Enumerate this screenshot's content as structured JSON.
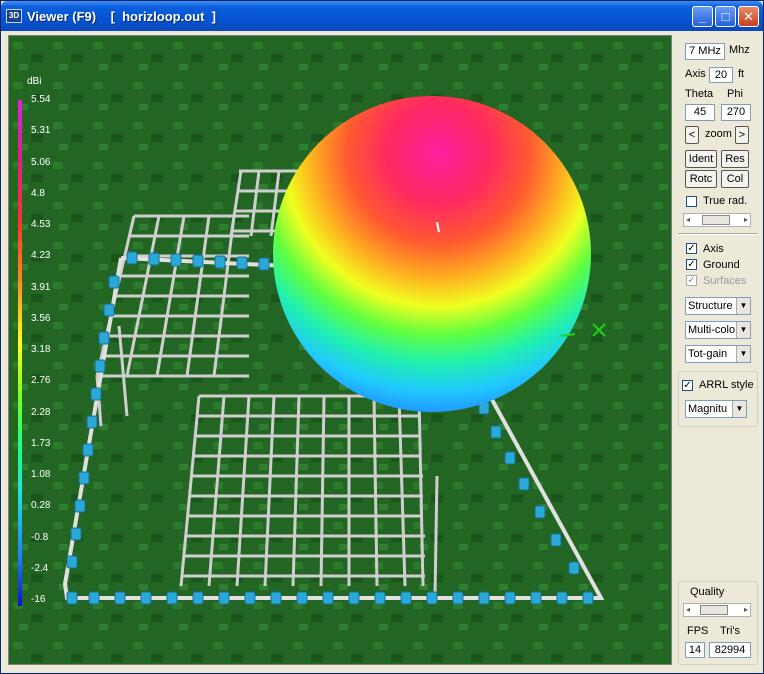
{
  "window": {
    "title": "Viewer (F9)    [  horizloop.out  ]",
    "icon_label": "3D",
    "buttons": {
      "minimize": "_",
      "maximize": "□",
      "close": "✕"
    }
  },
  "legend": {
    "unit": "dBi",
    "values": [
      "5.54",
      "5.31",
      "5.06",
      "4.8",
      "4.53",
      "4.23",
      "3.91",
      "3.56",
      "3.18",
      "2.76",
      "2.28",
      "1.73",
      "1.08",
      "0.28",
      "-0.8",
      "-2.4",
      "-16"
    ],
    "colors": {
      "top": "#e020e0",
      "bottom": "#1010d0"
    }
  },
  "controls": {
    "frequency": {
      "value": "7 MHz",
      "unit": "Mhz"
    },
    "axis": {
      "label": "Axis",
      "value": "20",
      "unit": "ft"
    },
    "theta": {
      "label": "Theta",
      "value": "45"
    },
    "phi": {
      "label": "Phi",
      "value": "270"
    },
    "zoom": {
      "prev": "<",
      "label": "zoom",
      "next": ">"
    },
    "buttons": {
      "ident": "Ident",
      "res": "Res",
      "rotc": "Rotc",
      "col": "Col"
    },
    "true_rad": {
      "label": "True rad.",
      "checked": false
    },
    "axis_check": {
      "label": "Axis",
      "checked": true
    },
    "ground_check": {
      "label": "Ground",
      "checked": true
    },
    "surfaces_check": {
      "label": "Surfaces",
      "checked": true,
      "disabled": true
    },
    "dropdowns": [
      "Structure",
      "Multi-colo",
      "Tot-gain"
    ],
    "arrl": {
      "label": "ARRL style",
      "checked": true
    },
    "arrl_dropdown": "Magnitu",
    "quality": {
      "label": "Quality"
    },
    "fps": {
      "label": "FPS",
      "value": "14"
    },
    "tris": {
      "label": "Tri's",
      "value": "82994"
    }
  },
  "colors": {
    "ground": "#236523",
    "accent": "#0a5fdc",
    "wire": "#cfcfcf",
    "segment_marker": "#2aa8d8"
  }
}
